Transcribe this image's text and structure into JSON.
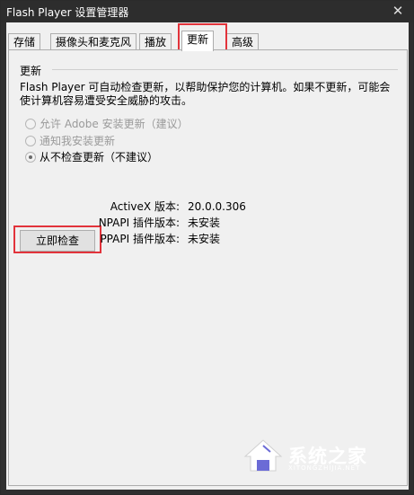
{
  "window": {
    "title": "Flash Player 设置管理器",
    "close_label": "✕"
  },
  "tabs": [
    {
      "label": "存储"
    },
    {
      "label": "摄像头和麦克风"
    },
    {
      "label": "播放"
    },
    {
      "label": "更新"
    },
    {
      "label": "高级"
    }
  ],
  "updates": {
    "group_title": "更新",
    "description": "Flash Player 可自动检查更新，以帮助保护您的计算机。如果不更新，可能会使计算机容易遭受安全威胁的攻击。",
    "options": [
      {
        "label": "允许 Adobe 安装更新（建议）",
        "checked": false,
        "enabled": false
      },
      {
        "label": "通知我安装更新",
        "checked": false,
        "enabled": false
      },
      {
        "label": "从不检查更新（不建议）",
        "checked": true,
        "enabled": true
      }
    ],
    "check_now_button": "立即检查",
    "versions": [
      {
        "label": "ActiveX 版本:",
        "value": "20.0.0.306"
      },
      {
        "label": "NPAPI 插件版本:",
        "value": "未安装"
      },
      {
        "label": "PPAPI 插件版本:",
        "value": "未安装"
      }
    ]
  },
  "watermark": {
    "text": "系统之家",
    "sub": "XITONGZHIJIA.NET",
    "icon": "house-logo-icon"
  },
  "colors": {
    "highlight": "#e2333b",
    "titlebar": "#2d2d2d",
    "client": "#f0f0f0"
  }
}
